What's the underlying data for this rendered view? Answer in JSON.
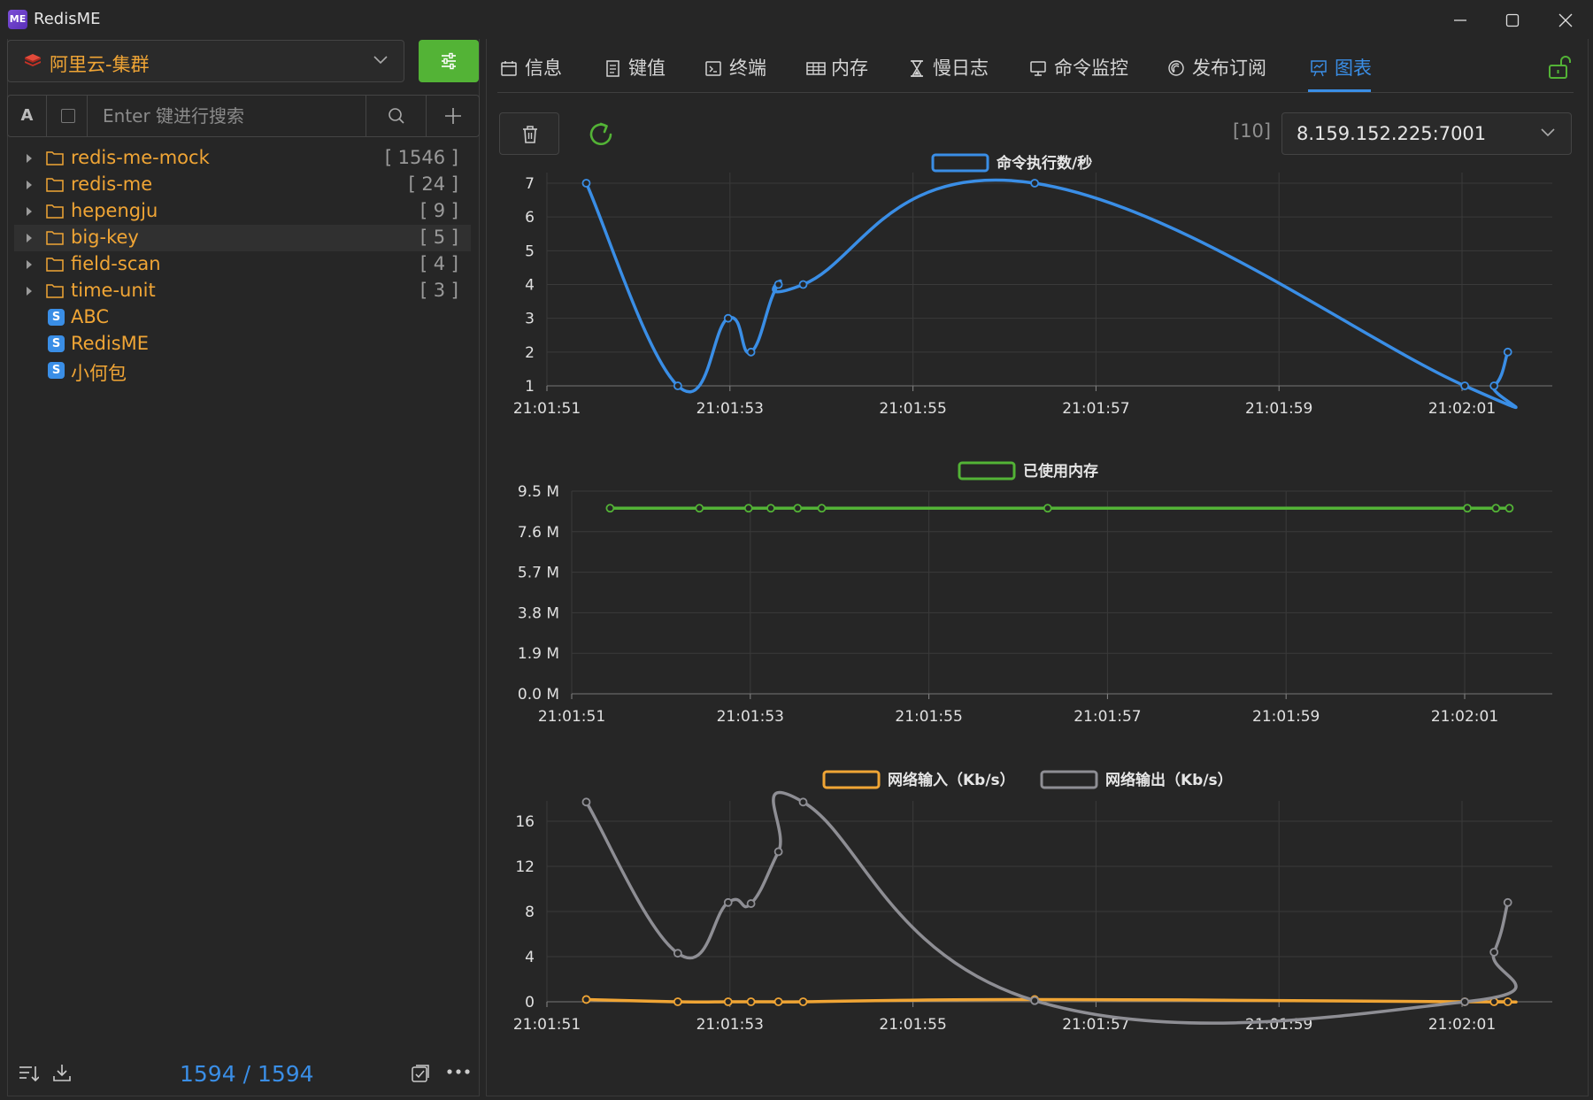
{
  "app": {
    "logo_text": "ME",
    "title": "RedisME"
  },
  "left": {
    "connection": "阿里云-集群",
    "search_mode": "A",
    "search_placeholder": "Enter 键进行搜索",
    "tree": [
      {
        "type": "folder",
        "name": "redis-me-mock",
        "count": "[ 1546 ]"
      },
      {
        "type": "folder",
        "name": "redis-me",
        "count": "[ 24 ]"
      },
      {
        "type": "folder",
        "name": "hepengju",
        "count": "[ 9 ]"
      },
      {
        "type": "folder",
        "name": "big-key",
        "count": "[ 5 ]",
        "highlighted": true
      },
      {
        "type": "folder",
        "name": "field-scan",
        "count": "[ 4 ]"
      },
      {
        "type": "folder",
        "name": "time-unit",
        "count": "[ 3 ]"
      },
      {
        "type": "key",
        "badge": "S",
        "name": "ABC"
      },
      {
        "type": "key",
        "badge": "S",
        "name": "RedisME"
      },
      {
        "type": "key",
        "badge": "S",
        "name": "小何包"
      }
    ],
    "key_count": "1594 / 1594"
  },
  "tabs": [
    {
      "label": "信息",
      "icon": "calendar-icon"
    },
    {
      "label": "键值",
      "icon": "document-icon"
    },
    {
      "label": "终端",
      "icon": "terminal-icon"
    },
    {
      "label": "内存",
      "icon": "table-icon"
    },
    {
      "label": "慢日志",
      "icon": "hourglass-icon"
    },
    {
      "label": "命令监控",
      "icon": "monitor-icon"
    },
    {
      "label": "发布订阅",
      "icon": "broadcast-icon"
    },
    {
      "label": "图表",
      "icon": "chart-icon",
      "active": true
    }
  ],
  "toolbar": {
    "count_tag": "[10]",
    "node": "8.159.152.225:7001"
  },
  "colors": {
    "accent": "#3a8ee6",
    "green": "#53b336",
    "orange": "#f0a535",
    "gray_series": "#8e8e94"
  },
  "chart_data": [
    {
      "type": "line",
      "legend": [
        "命令执行数/秒"
      ],
      "x_ticks": [
        "21:01:51",
        "21:01:53",
        "21:01:55",
        "21:01:57",
        "21:01:59",
        "21:02:01"
      ],
      "ylim": [
        1,
        7
      ],
      "y_ticks": [
        "1",
        "2",
        "3",
        "4",
        "5",
        "6",
        "7"
      ],
      "series": [
        {
          "name": "命令执行数/秒",
          "color": "#3a8ee6",
          "x": [
            51.43,
            52.43,
            52.98,
            53.23,
            53.53,
            53.8,
            56.33,
            61.03,
            61.35,
            61.5
          ],
          "values": [
            7,
            1,
            3,
            2,
            4,
            4,
            7,
            1,
            1,
            2
          ]
        }
      ]
    },
    {
      "type": "line",
      "legend": [
        "已使用内存"
      ],
      "x_ticks": [
        "21:01:51",
        "21:01:53",
        "21:01:55",
        "21:01:57",
        "21:01:59",
        "21:02:01"
      ],
      "ylim": [
        0,
        9.5
      ],
      "y_ticks": [
        "0.0 M",
        "1.9 M",
        "3.8 M",
        "5.7 M",
        "7.6 M",
        "9.5 M"
      ],
      "series": [
        {
          "name": "已使用内存",
          "color": "#53b336",
          "x": [
            51.43,
            52.43,
            52.98,
            53.23,
            53.53,
            53.8,
            56.33,
            61.03,
            61.35,
            61.5
          ],
          "values": [
            8.7,
            8.7,
            8.7,
            8.7,
            8.7,
            8.7,
            8.7,
            8.7,
            8.7,
            8.7
          ]
        }
      ]
    },
    {
      "type": "line",
      "legend": [
        "网络输入（Kb/s）",
        "网络输出（Kb/s）"
      ],
      "x_ticks": [
        "21:01:51",
        "21:01:53",
        "21:01:55",
        "21:01:57",
        "21:01:59",
        "21:02:01"
      ],
      "ylim": [
        0,
        16
      ],
      "y_ticks": [
        "0",
        "4",
        "8",
        "12",
        "16"
      ],
      "series": [
        {
          "name": "网络输入（Kb/s）",
          "color": "#f0a535",
          "x": [
            51.43,
            52.43,
            52.98,
            53.23,
            53.53,
            53.8,
            56.33,
            61.03,
            61.35,
            61.5
          ],
          "values": [
            0.2,
            0,
            0,
            0,
            0,
            0,
            0.2,
            0,
            0,
            0
          ]
        },
        {
          "name": "网络输出（Kb/s）",
          "color": "#8e8e94",
          "x": [
            51.43,
            52.43,
            52.98,
            53.23,
            53.53,
            53.8,
            56.33,
            61.03,
            61.35,
            61.5
          ],
          "values": [
            17.7,
            4.3,
            8.8,
            8.7,
            13.3,
            17.7,
            0.1,
            0,
            4.4,
            8.8
          ]
        }
      ]
    }
  ]
}
